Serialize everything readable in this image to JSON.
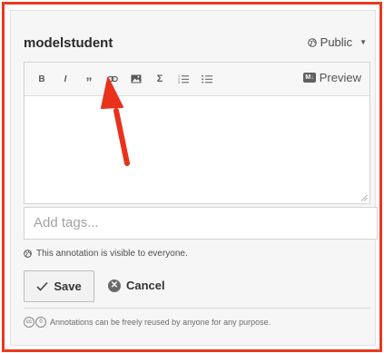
{
  "header": {
    "username": "modelstudent",
    "privacy_label": "Public",
    "privacy_icon": "globe-icon",
    "caret_icon": "caret-down-icon"
  },
  "toolbar": {
    "buttons": [
      {
        "name": "bold-button",
        "glyph": "B",
        "icon": "bold-icon"
      },
      {
        "name": "italic-button",
        "glyph": "I",
        "icon": "italic-icon"
      },
      {
        "name": "quote-button",
        "glyph": "”",
        "icon": "quote-icon"
      },
      {
        "name": "link-button",
        "glyph": "",
        "icon": "link-icon"
      },
      {
        "name": "image-button",
        "glyph": "",
        "icon": "image-icon"
      },
      {
        "name": "math-button",
        "glyph": "Σ",
        "icon": "sigma-icon"
      },
      {
        "name": "numbered-list-button",
        "glyph": "",
        "icon": "numbered-list-icon"
      },
      {
        "name": "bullet-list-button",
        "glyph": "",
        "icon": "bullet-list-icon"
      }
    ],
    "preview_badge": "M↓",
    "preview_label": "Preview"
  },
  "editor": {
    "value": ""
  },
  "tags": {
    "placeholder": "Add tags..."
  },
  "visibility_note": "This annotation is visible to everyone.",
  "actions": {
    "save_label": "Save",
    "cancel_label": "Cancel"
  },
  "license": {
    "text": "Annotations can be freely reused by anyone for any purpose.",
    "badge": [
      "cc",
      "0"
    ]
  },
  "colors": {
    "highlight_border": "#e9391f",
    "arrow": "#e8321c",
    "card_bg": "#f6f6f6"
  }
}
